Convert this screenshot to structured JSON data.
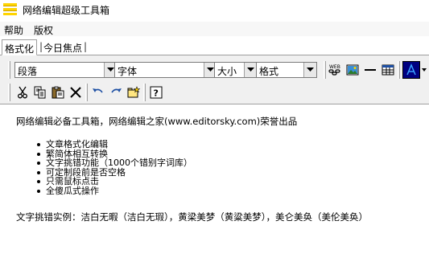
{
  "window": {
    "title": "网络编辑超级工具箱"
  },
  "menubar": {
    "items": [
      "帮助",
      "版权"
    ]
  },
  "tabs": {
    "items": [
      {
        "label": "格式化",
        "active": true
      },
      {
        "label": "今日焦点",
        "active": false
      }
    ]
  },
  "toolbar": {
    "paragraph_combo": "段落",
    "font_combo": "字体",
    "size_combo": "大小",
    "format_combo": "格式",
    "icons": [
      "web-links-icon",
      "insert-image-icon",
      "horizontal-line-icon",
      "insert-table-icon",
      "text-color-icon"
    ],
    "edit_icons": [
      "cut-icon",
      "copy-icon",
      "paste-icon",
      "delete-icon",
      "undo-icon",
      "redo-icon",
      "open-file-icon",
      "help-icon"
    ]
  },
  "colors": {
    "title_icon": "#ffd400",
    "toolbar_bg": "#f0f0f0",
    "text_color_btn": "#000080"
  },
  "editor": {
    "intro": "网络编辑必备工具箱，网络编辑之家(www.editorsky.com)荣誉出品",
    "features": [
      "文章格式化编辑",
      "繁简体相互转换",
      "文字挑错功能（1000个错别字词库）",
      "可定制段前是否空格",
      "只需鼠标点击",
      "全傻瓜式操作"
    ],
    "example": "文字挑错实例：洁白无暇（洁白无瑕），黄梁美梦（黄粱美梦），美仑美奂（美伦美奂）"
  }
}
